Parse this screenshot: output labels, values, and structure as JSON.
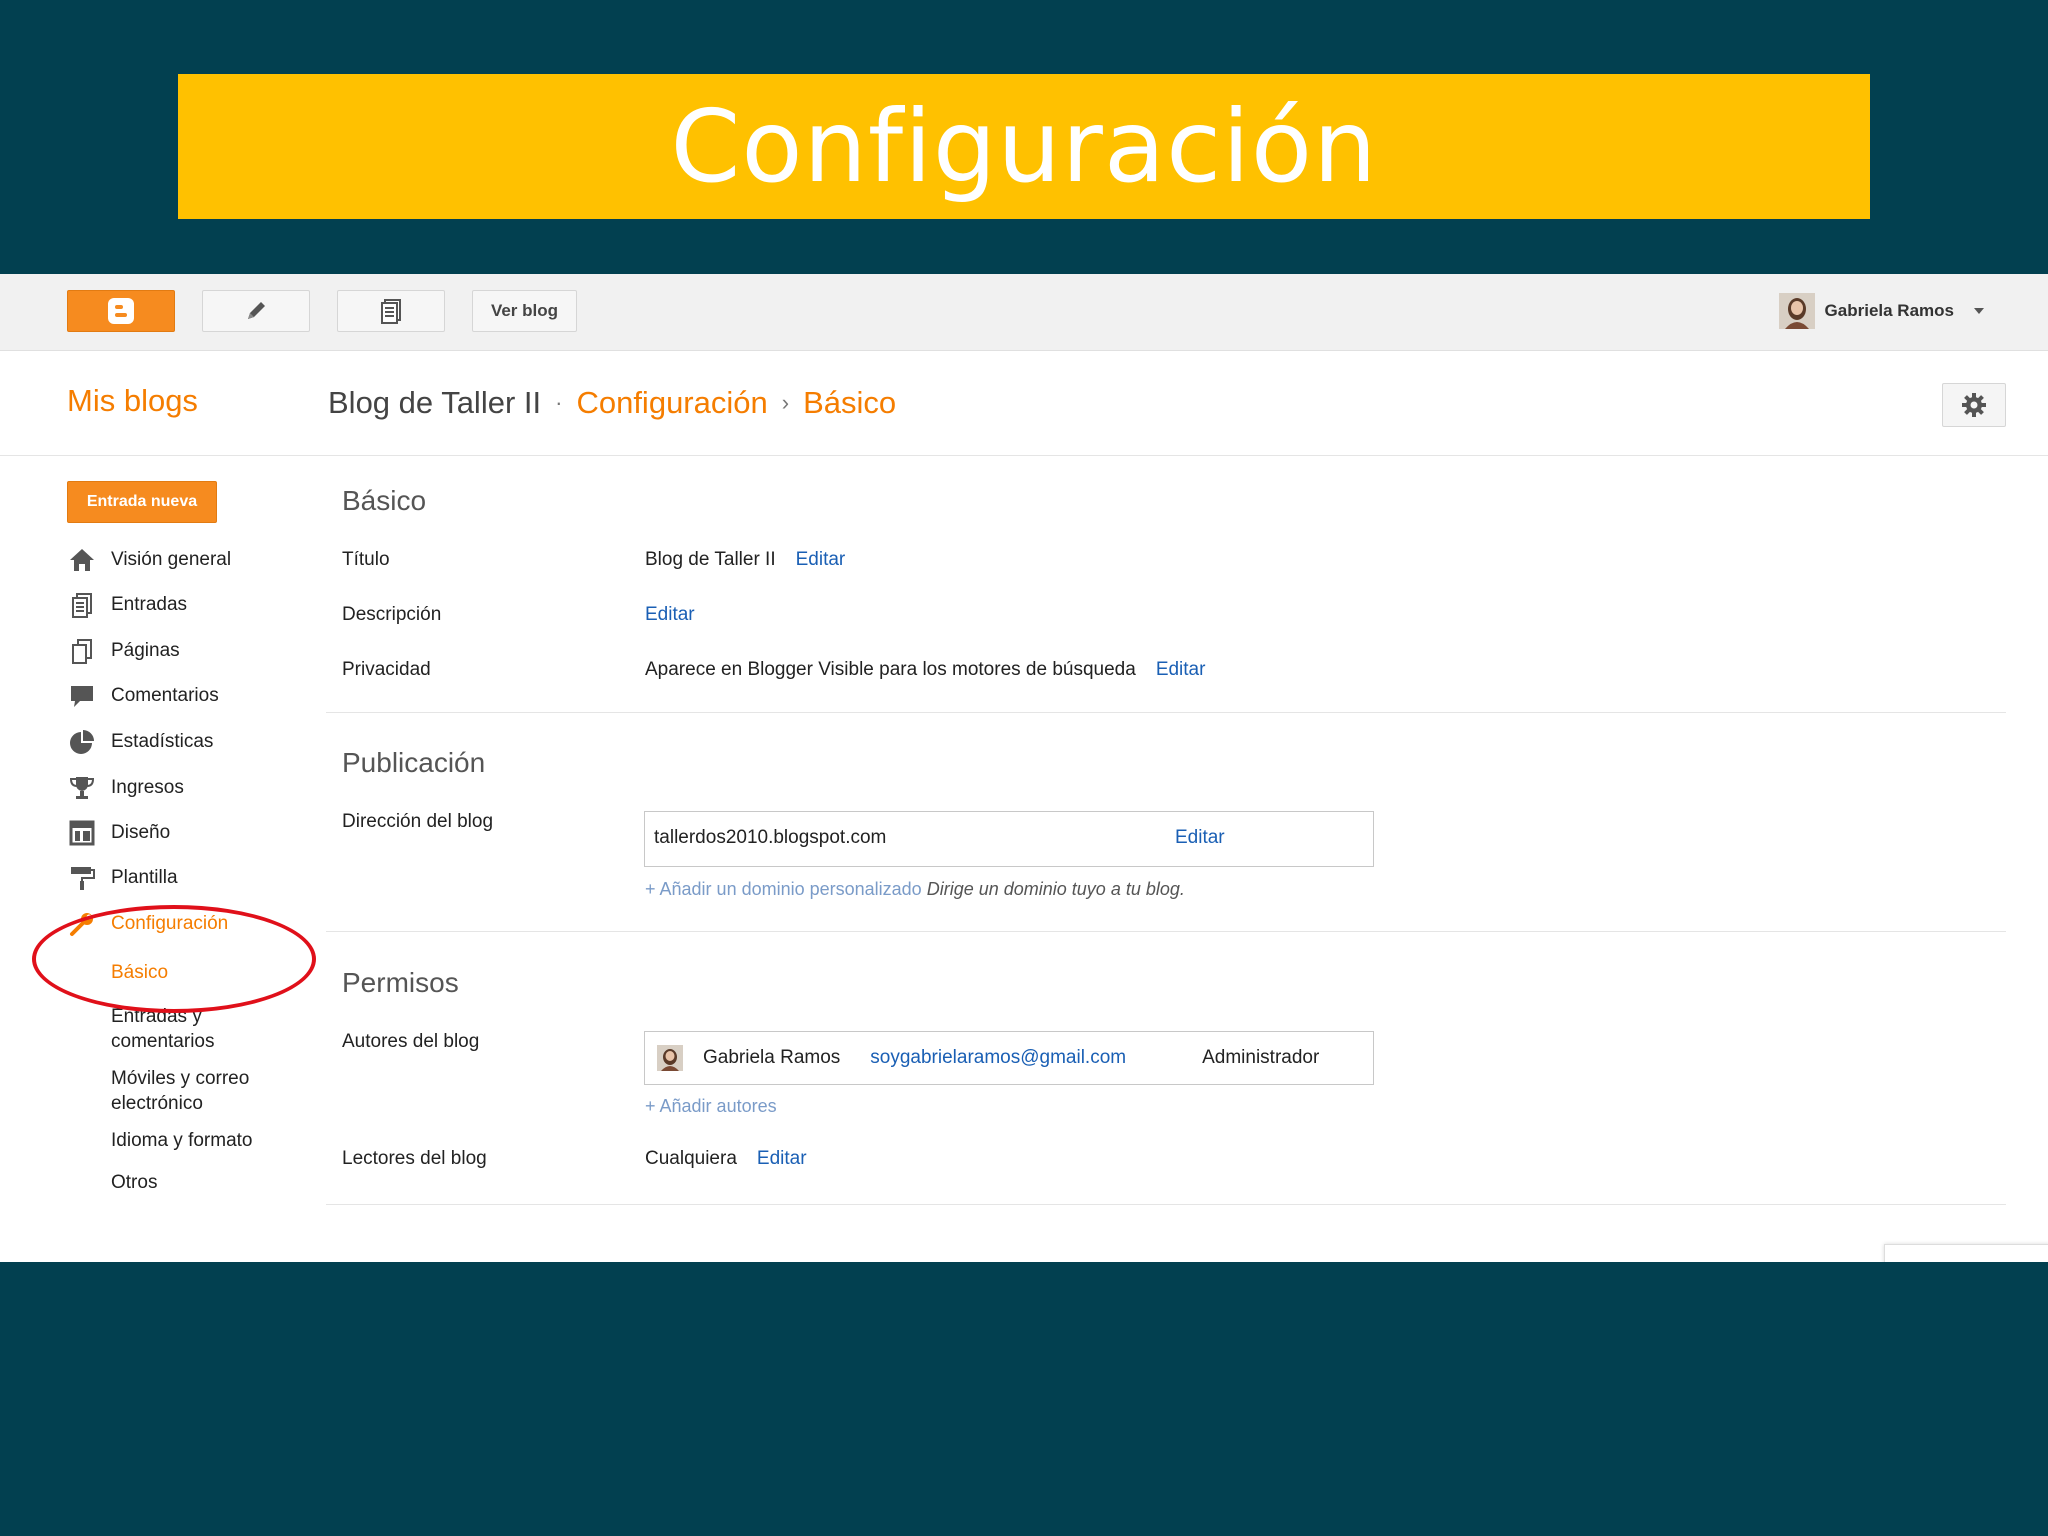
{
  "slide": {
    "title": "Configuración"
  },
  "topbar": {
    "blogger_icon": "blogger-logo-icon",
    "pencil_icon": "pencil-icon",
    "posts_icon": "posts-icon",
    "view_blog_label": "Ver blog",
    "user_name": "Gabriela Ramos",
    "accent_color": "#f68b1f"
  },
  "header": {
    "my_blogs": "Mis blogs",
    "blog_name": "Blog de Taller II",
    "crumb_dot": "·",
    "crumb_settings": "Configuración",
    "crumb_arrow": "›",
    "crumb_basic": "Básico"
  },
  "sidebar": {
    "new_post": "Entrada nueva",
    "items": [
      {
        "label": "Visión general",
        "icon": "home-icon"
      },
      {
        "label": "Entradas",
        "icon": "posts-icon"
      },
      {
        "label": "Páginas",
        "icon": "pages-icon"
      },
      {
        "label": "Comentarios",
        "icon": "comments-icon"
      },
      {
        "label": "Estadísticas",
        "icon": "stats-pie-icon"
      },
      {
        "label": "Ingresos",
        "icon": "trophy-icon"
      },
      {
        "label": "Diseño",
        "icon": "layout-icon"
      },
      {
        "label": "Plantilla",
        "icon": "paint-roller-icon"
      },
      {
        "label": "Configuración",
        "icon": "wrench-icon"
      }
    ],
    "sub_items": [
      "Básico",
      "Entradas y comentarios",
      "Móviles y correo electrónico",
      "Idioma y formato",
      "Otros"
    ]
  },
  "basic": {
    "title": "Básico",
    "title_label": "Título",
    "title_value": "Blog de Taller II",
    "description_label": "Descripción",
    "privacy_label": "Privacidad",
    "privacy_value": "Aparece en Blogger Visible para los motores de búsqueda",
    "edit": "Editar"
  },
  "publication": {
    "title": "Publicación",
    "address_label": "Dirección del blog",
    "address_value": "tallerdos2010.blogspot.com",
    "edit": "Editar",
    "add_domain": "+ Añadir un dominio personalizado",
    "domain_hint": "Dirige un dominio tuyo a tu blog."
  },
  "permissions": {
    "title": "Permisos",
    "authors_label": "Autores del blog",
    "author_name": "Gabriela Ramos",
    "author_email": "soygabrielaramos@gmail.com",
    "author_role": "Administrador",
    "add_authors": "+ Añadir autores",
    "readers_label": "Lectores del blog",
    "readers_value": "Cualquiera",
    "edit": "Editar"
  }
}
